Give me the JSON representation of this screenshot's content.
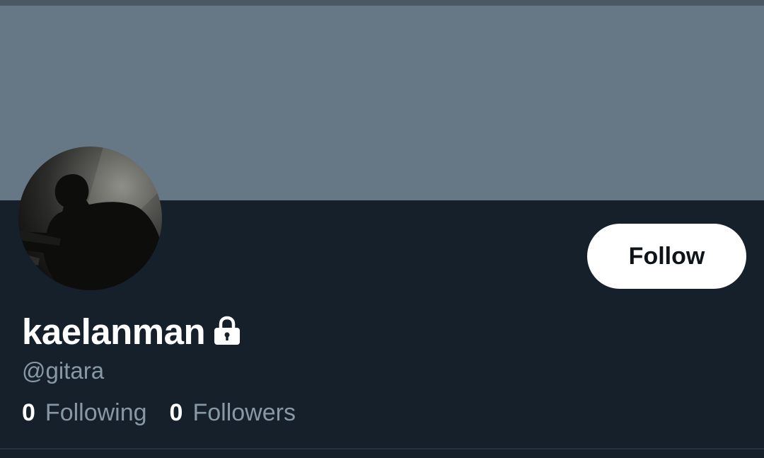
{
  "profile": {
    "display_name": "kaelanman",
    "handle": "@gitara",
    "protected_icon": "lock-icon",
    "avatar_icon": "profile-photo"
  },
  "actions": {
    "follow_label": "Follow"
  },
  "stats": {
    "following_count": "0",
    "following_label": "Following",
    "followers_count": "0",
    "followers_label": "Followers"
  },
  "colors": {
    "background": "#15202b",
    "banner": "#667786",
    "secondary_text": "#8899a6",
    "button_bg": "#ffffff"
  }
}
